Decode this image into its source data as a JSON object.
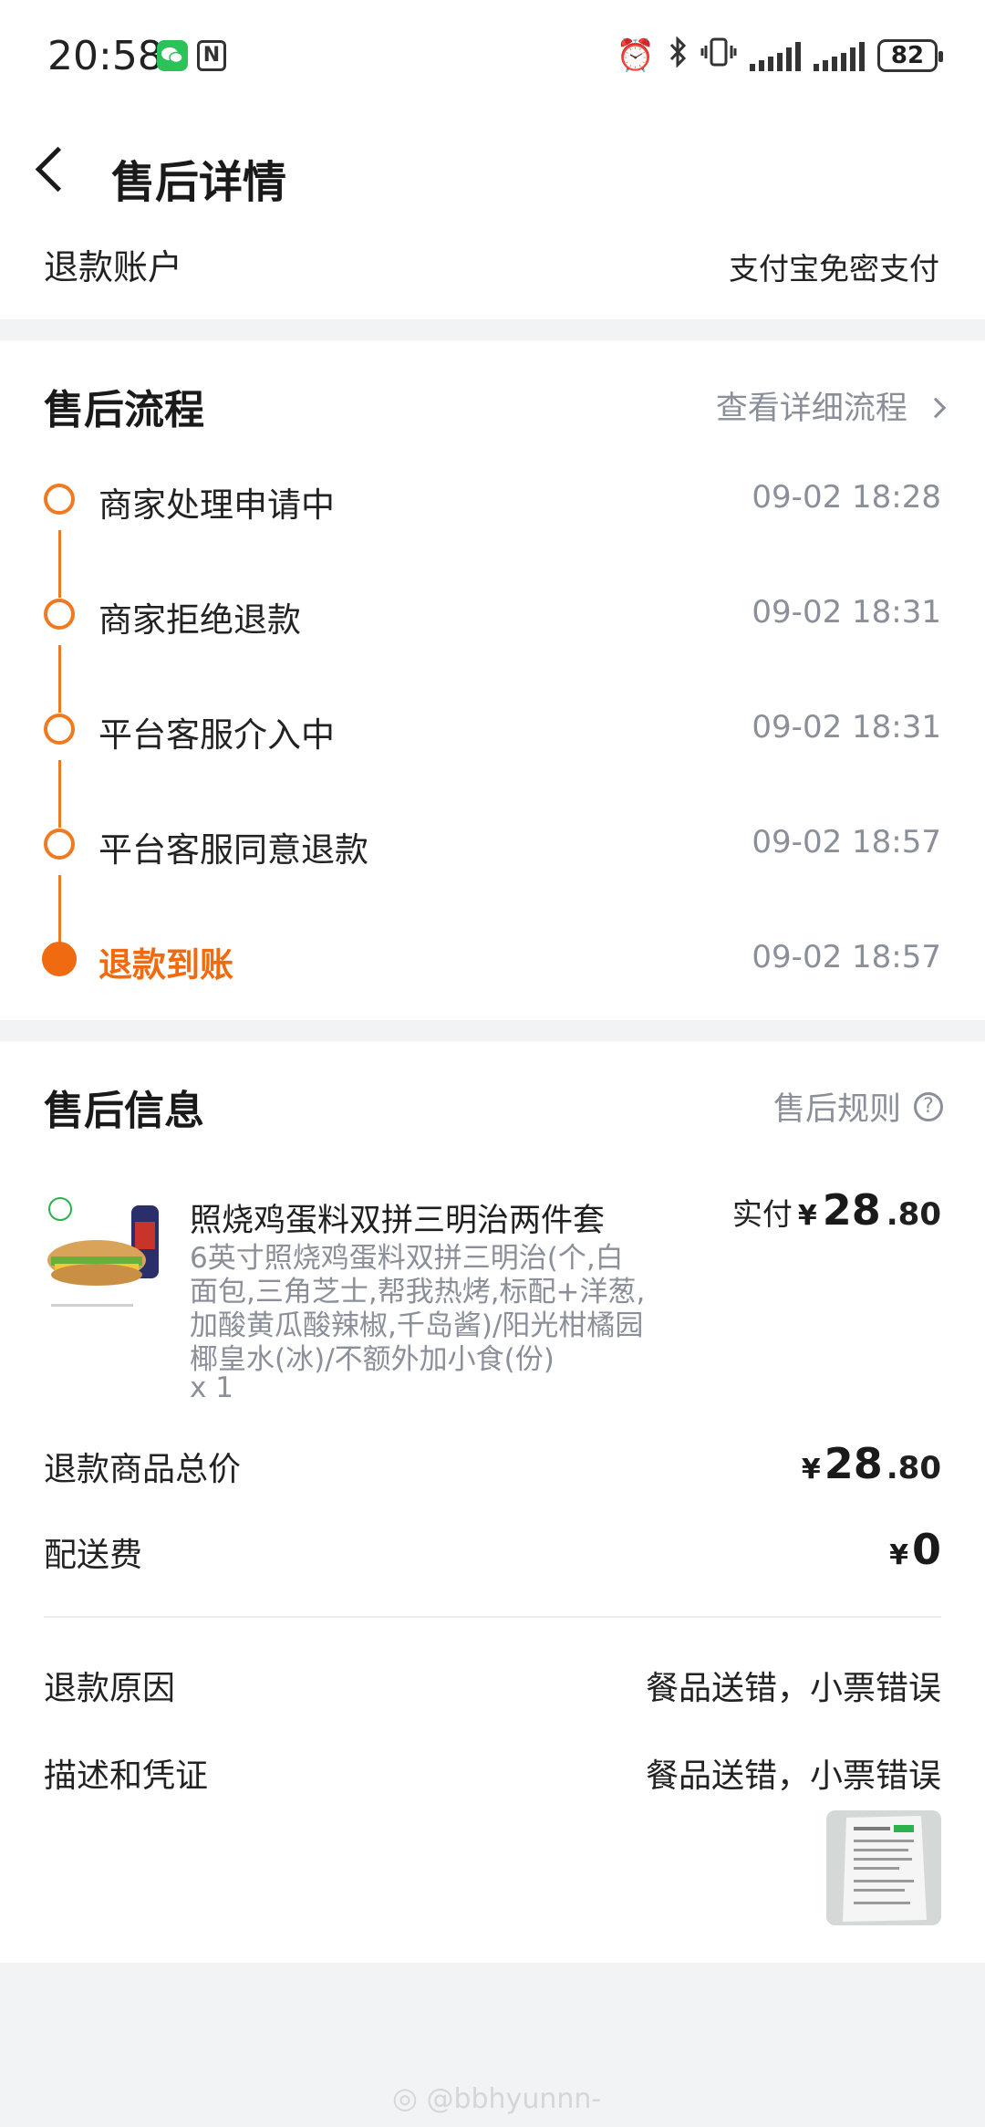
{
  "status_bar": {
    "time": "20:58",
    "battery": "82",
    "icons": [
      "wechat-icon",
      "nfc-icon",
      "alarm-icon",
      "bluetooth-icon",
      "vibrate-icon",
      "signal-icon",
      "signal-icon",
      "battery-icon"
    ]
  },
  "header": {
    "title": "售后详情",
    "refund_account_label": "退款账户",
    "refund_account_value": "支付宝免密支付"
  },
  "process": {
    "title": "售后流程",
    "detail_link": "查看详细流程",
    "steps": [
      {
        "label": "商家处理申请中",
        "time": "09-02 18:28"
      },
      {
        "label": "商家拒绝退款",
        "time": "09-02 18:31"
      },
      {
        "label": "平台客服介入中",
        "time": "09-02 18:31"
      },
      {
        "label": "平台客服同意退款",
        "time": "09-02 18:57"
      },
      {
        "label": "退款到账",
        "time": "09-02 18:57"
      }
    ]
  },
  "info": {
    "title": "售后信息",
    "rules_link": "售后规则",
    "product": {
      "name": "照烧鸡蛋料双拼三明治两件套",
      "desc_lines": [
        "6英寸照烧鸡蛋料双拼三明治(个,白",
        "面包,三角芝士,帮我热烤,标配+洋葱,",
        "加酸黄瓜酸辣椒,千岛酱)/阳光柑橘园",
        "椰皇水(冰)/不额外加小食(份)"
      ],
      "qty": "x 1",
      "paid_label": "实付",
      "currency": "¥",
      "paid_int": "28",
      "paid_dec": ".80"
    },
    "total_label": "退款商品总价",
    "total_currency": "¥",
    "total_int": "28",
    "total_dec": ".80",
    "delivery_label": "配送费",
    "delivery_currency": "¥",
    "delivery_value": "0",
    "reason_label": "退款原因",
    "reason_value": "餐品送错，小票错误",
    "evidence_label": "描述和凭证",
    "evidence_value": "餐品送错，小票错误"
  },
  "watermark": "@bbhyunnn-",
  "colors": {
    "accent": "#f06a0f",
    "muted": "#8a8f99",
    "background": "#f2f3f5"
  }
}
